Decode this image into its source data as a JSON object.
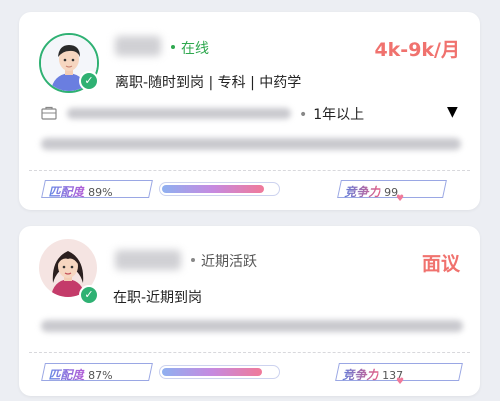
{
  "candidates": [
    {
      "status": "在线",
      "status_color": "#2fa84f",
      "salary": "4k-9k/月",
      "subline": "离职-随时到岗 | 专科 | 中药学",
      "experience": "1年以上",
      "dropdown_icon": "▼",
      "match_label": "匹配度",
      "match_value": "89%",
      "match_fraction": 0.89,
      "compete_label": "竞争力",
      "compete_value": "99"
    },
    {
      "status": "近期活跃",
      "status_color": "#888888",
      "salary": "面议",
      "subline": "在职-近期到岗",
      "match_label": "匹配度",
      "match_value": "87%",
      "match_fraction": 0.87,
      "compete_label": "竞争力",
      "compete_value": "137"
    }
  ],
  "icons": {
    "online_check": "checkmark-icon",
    "company": "briefcase-icon",
    "dropdown": "triangle-down-icon"
  },
  "colors": {
    "accent_salary": "#f0726e",
    "online_green": "#2fb173"
  }
}
